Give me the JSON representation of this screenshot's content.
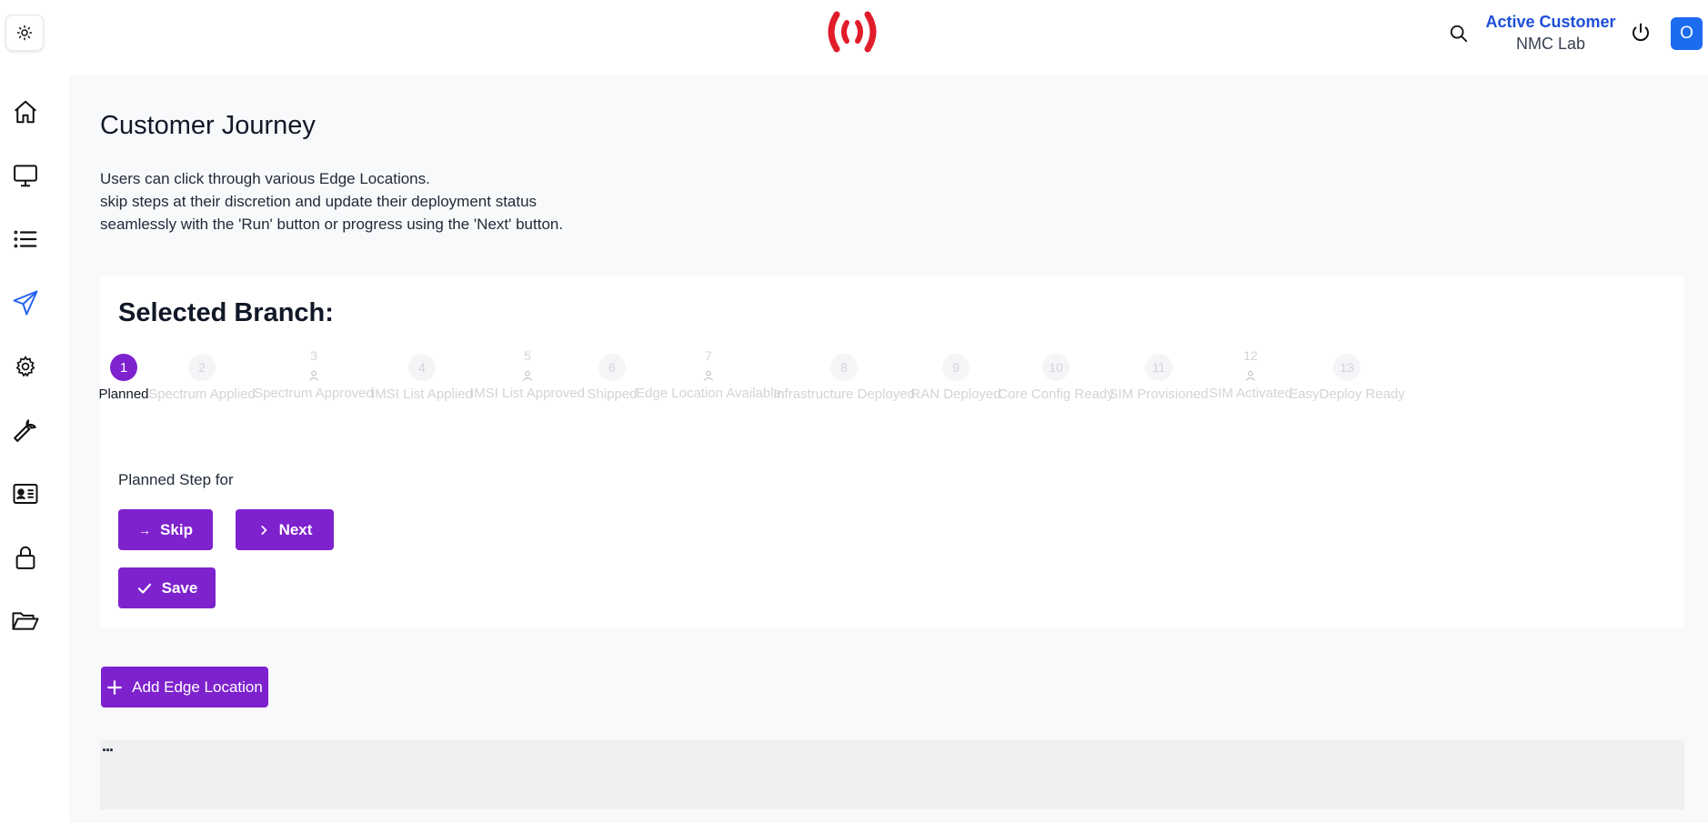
{
  "header": {
    "customer_name": "Active Customer",
    "customer_sub": "NMC Lab",
    "avatar_letter": "O",
    "brand_color": "#e11d2a",
    "accent_color": "#7e22ce",
    "link_color": "#1d4ed8"
  },
  "icons": {
    "theme": "sun-icon",
    "logo": "broadcast-logo",
    "search": "search-icon",
    "power": "power-icon"
  },
  "sidebar": {
    "items": [
      {
        "name": "home",
        "icon": "home-icon",
        "active": false
      },
      {
        "name": "monitor",
        "icon": "monitor-icon",
        "active": false
      },
      {
        "name": "list",
        "icon": "list-icon",
        "active": false
      },
      {
        "name": "journey",
        "icon": "send-icon",
        "active": true
      },
      {
        "name": "settings",
        "icon": "gear-icon",
        "active": false
      },
      {
        "name": "tools",
        "icon": "wrench-icon",
        "active": false
      },
      {
        "name": "contacts",
        "icon": "id-card-icon",
        "active": false
      },
      {
        "name": "security",
        "icon": "lock-icon",
        "active": false
      },
      {
        "name": "files",
        "icon": "folder-open-icon",
        "active": false
      }
    ]
  },
  "page": {
    "title": "Customer Journey",
    "desc_line1": "Users can click through various Edge Locations.",
    "desc_line2": "skip steps at their discretion and update their deployment status",
    "desc_line3": "seamlessly with the 'Run' button or progress using the 'Next' button."
  },
  "card": {
    "title": "Selected Branch:",
    "planned_step_text": "Planned Step for",
    "skip_label": "Skip",
    "next_label": "Next",
    "save_label": "Save"
  },
  "steps": [
    {
      "num": "1",
      "label": "Planned",
      "active": true,
      "person": false
    },
    {
      "num": "2",
      "label": "Spectrum Applied",
      "active": false,
      "person": false
    },
    {
      "num": "3",
      "label": "Spectrum Approved",
      "active": false,
      "person": true
    },
    {
      "num": "4",
      "label": "IMSI List Applied",
      "active": false,
      "person": false
    },
    {
      "num": "5",
      "label": "IMSI List Approved",
      "active": false,
      "person": true
    },
    {
      "num": "6",
      "label": "Shipped",
      "active": false,
      "person": false
    },
    {
      "num": "7",
      "label": "Edge Location Available",
      "active": false,
      "person": true
    },
    {
      "num": "8",
      "label": "Infrastructure Deployed",
      "active": false,
      "person": false
    },
    {
      "num": "9",
      "label": "RAN Deployed",
      "active": false,
      "person": false
    },
    {
      "num": "10",
      "label": "Core Config Ready",
      "active": false,
      "person": false
    },
    {
      "num": "11",
      "label": "SIM Provisioned",
      "active": false,
      "person": false
    },
    {
      "num": "12",
      "label": "SIM Activated",
      "active": false,
      "person": true
    },
    {
      "num": "13",
      "label": "EasyDeploy Ready",
      "active": false,
      "person": false
    }
  ],
  "add_edge_label": "Add Edge Location",
  "more_text": "..."
}
